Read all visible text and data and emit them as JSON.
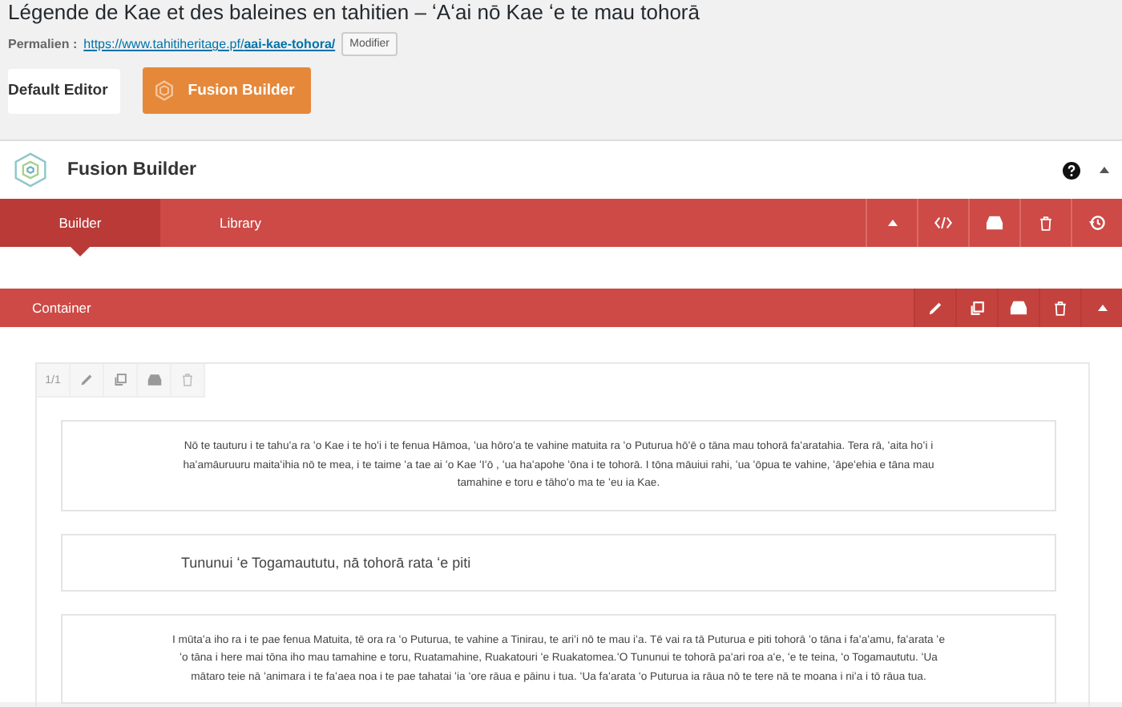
{
  "page_title": "Légende de Kae et des baleines en tahitien – ʻAʻai nō Kae ʻe te mau tohorā",
  "permalink": {
    "label": "Permalien :",
    "url": "https://www.tahitiheritage.pf/**aai-kae-tohora/**",
    "button": "Modifier"
  },
  "editor_buttons": [
    {
      "label": "Default Editor",
      "selected": false
    },
    {
      "label": "Fusion Builder",
      "selected": true
    }
  ],
  "builder": {
    "title": "Fusion Builder"
  },
  "tabs": [
    {
      "label": "Builder",
      "selected": true
    },
    {
      "label": "Library",
      "selected": false
    }
  ],
  "container": {
    "title": "Container"
  },
  "column": {
    "size": "1/1"
  },
  "elements": [
    {
      "kind": "text",
      "lines": [
        "Nō te tauturu i te tahuʻa ra ʻo Kae i te hoʻi i te fenua Hāmoa, ʻua hōroʻa te vahine matuita ra ʻo Puturua hōʻē o tāna mau tohorā faʻaratahia. Tera rā, ʻaita hoʻi i",
        "haʻamāuruuru maitaʻihia nō te mea, i te taime ʻa tae ai ʻo Kae ʻIʻō , ʻua haʻapohe ʻōna i te tohorā. I tōna māuiui rahi, ʻua ʻōpua te vahine, ʻāpeʻehia e tāna mau",
        "tamahine e toru e tāhoʻo ma te ʻeu ia Kae."
      ]
    },
    {
      "kind": "heading",
      "lines": [
        "Tununui ʻe Togamaututu, nā tohorā rata ʻe piti"
      ]
    },
    {
      "kind": "text",
      "lines": [
        "I mūtaʻa iho ra i te pae fenua Matuita, tē ora ra ʻo Puturua, te vahine a Tinirau, te ariʻi nō te mau iʻa. Tē vai ra tā Puturua e piti tohorā ʻo tāna i faʻaʻamu, faʻarata ʻe",
        "ʻo tāna i here mai tōna iho mau tamahine e toru, Ruatamahine, Ruakatouri ʻe Ruakatomea.ʻO Tununui te tohorā paʻari roa aʻe, ʻe te teina, ʻo Togamaututu. ʻUa",
        "mātaro teie nā ʻanimara i te faʻaea noa i te pae tahatai ʻia ʻore rāua e pāinu i tua. ʻUa faʻarata ʻo Puturua ia rāua nō te tere nā te moana i niʻa i tō rāua tua."
      ]
    }
  ]
}
